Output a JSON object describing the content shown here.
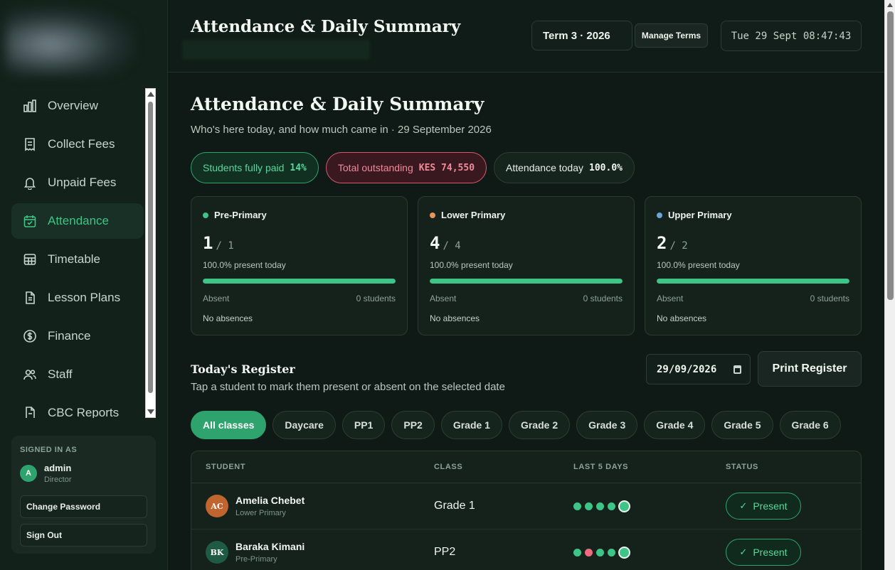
{
  "header": {
    "title": "Attendance & Daily Summary",
    "term": "Term 3 · 2026",
    "manage_terms": "Manage Terms",
    "clock": "Tue 29 Sept 08:47:43"
  },
  "sidebar": {
    "items": [
      {
        "label": "Overview",
        "icon": "bar-chart-icon"
      },
      {
        "label": "Collect Fees",
        "icon": "receipt-icon"
      },
      {
        "label": "Unpaid Fees",
        "icon": "bell-icon"
      },
      {
        "label": "Attendance",
        "icon": "calendar-check-icon"
      },
      {
        "label": "Timetable",
        "icon": "table-icon"
      },
      {
        "label": "Lesson Plans",
        "icon": "document-icon"
      },
      {
        "label": "Finance",
        "icon": "dollar-icon"
      },
      {
        "label": "Staff",
        "icon": "users-icon"
      },
      {
        "label": "CBC Reports",
        "icon": "report-icon"
      }
    ],
    "signed_in": {
      "caption": "SIGNED IN AS",
      "avatar": "A",
      "name": "admin",
      "role": "Director",
      "change_password": "Change Password",
      "sign_out": "Sign Out"
    }
  },
  "page": {
    "title": "Attendance & Daily Summary",
    "subtitle": "Who's here today, and how much came in · 29 September 2026",
    "pills": {
      "paid_label": "Students fully paid",
      "paid_value": "14%",
      "outstanding_label": "Total outstanding",
      "outstanding_value": "KES 74,550",
      "attendance_label": "Attendance today",
      "attendance_value": "100.0%"
    },
    "cards": [
      {
        "name": "Pre-Primary",
        "color": "#3ec486",
        "present": "1",
        "total": "/ 1",
        "pct": "100.0% present today",
        "fill": 1.0,
        "absent_label": "Absent",
        "absent_count": "0 students",
        "note": "No absences"
      },
      {
        "name": "Lower Primary",
        "color": "#e8935a",
        "present": "4",
        "total": "/ 4",
        "pct": "100.0% present today",
        "fill": 1.0,
        "absent_label": "Absent",
        "absent_count": "0 students",
        "note": "No absences"
      },
      {
        "name": "Upper Primary",
        "color": "#6aa6d8",
        "present": "2",
        "total": "/ 2",
        "pct": "100.0% present today",
        "fill": 1.0,
        "absent_label": "Absent",
        "absent_count": "0 students",
        "note": "No absences"
      }
    ],
    "register": {
      "title": "Today's Register",
      "subtitle": "Tap a student to mark them present or absent on the selected date",
      "date": "29/09/2026",
      "print": "Print Register"
    },
    "chips": [
      "All classes",
      "Daycare",
      "PP1",
      "PP2",
      "Grade 1",
      "Grade 2",
      "Grade 3",
      "Grade 4",
      "Grade 5",
      "Grade 6"
    ],
    "table": {
      "headers": [
        "STUDENT",
        "CLASS",
        "LAST 5 DAYS",
        "STATUS"
      ],
      "rows": [
        {
          "initials": "AC",
          "avatar_color": "#c0652f",
          "name": "Amelia Chebet",
          "group": "Lower Primary",
          "class": "Grade 1",
          "days": [
            "present",
            "present",
            "present",
            "present",
            "present"
          ],
          "status": "Present"
        },
        {
          "initials": "BK",
          "avatar_color": "#1f5a45",
          "name": "Baraka Kimani",
          "group": "Pre-Primary",
          "class": "PP2",
          "days": [
            "present",
            "absent",
            "present",
            "present",
            "present"
          ],
          "status": "Present"
        }
      ]
    }
  }
}
